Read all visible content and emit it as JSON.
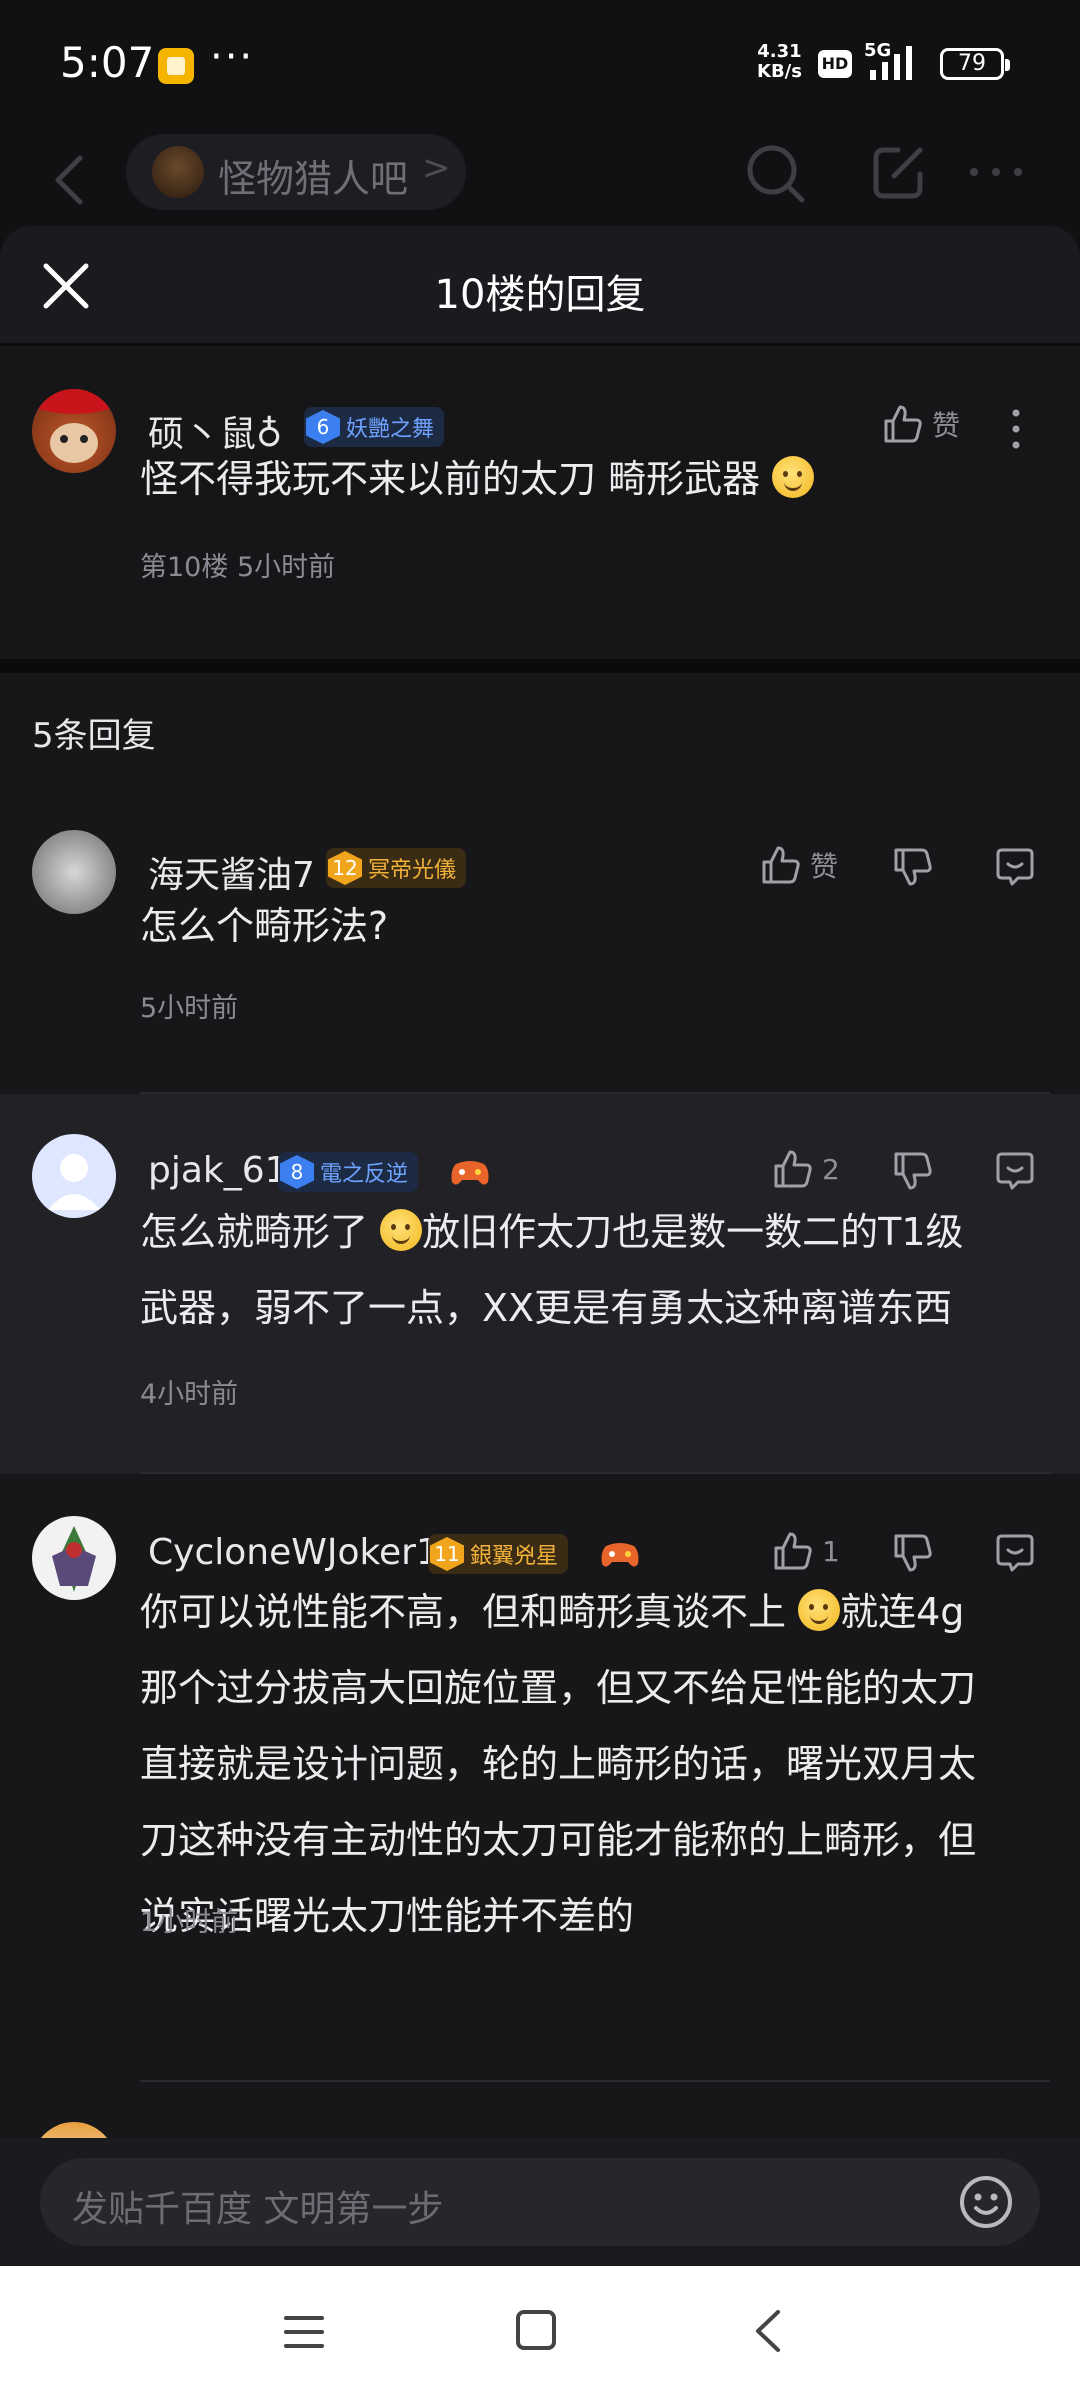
{
  "status": {
    "time": "5:07",
    "dots": "···",
    "speed_value": "4.31",
    "speed_unit": "KB/s",
    "hd": "HD",
    "network": "5G",
    "battery": "79"
  },
  "nav": {
    "forum_name": "怪物猎人吧",
    "chevron": ">"
  },
  "sheet": {
    "title": "10楼的回复"
  },
  "main_post": {
    "username": "硕丶鼠♁",
    "level": "6",
    "level_title": "妖艷之舞",
    "text": "怪不得我玩不来以前的太刀 畸形武器",
    "meta": "第10楼  5小时前",
    "like_label": "赞"
  },
  "replies_count": "5条回复",
  "replies": [
    {
      "username": "海天酱油7",
      "level": "12",
      "level_title": "冥帝光儀",
      "like_label": "赞",
      "text": "怎么个畸形法?",
      "time": "5小时前"
    },
    {
      "username": "pjak_61",
      "level": "8",
      "level_title": "電之反逆",
      "like_label": "2",
      "text_1": "怎么就畸形了",
      "text_2": "放旧作太刀也是数一数二的T1级",
      "text_3": "武器，弱不了一点，XX更是有勇太这种离谱东西",
      "time": "4小时前"
    },
    {
      "username": "CycloneWJoker1",
      "level": "11",
      "level_title": "銀翼兇星",
      "like_label": "1",
      "text_1": "你可以说性能不高，但和畸形真谈不上",
      "text_2": "就连4g",
      "text_3": "那个过分拔高大回旋位置，但又不给足性能的太刀",
      "text_4": "直接就是设计问题，轮的上畸形的话，曙光双月太",
      "text_5": "刀这种没有主动性的太刀可能才能称的上畸形，但",
      "text_6": "说实话曙光太刀性能并不差的",
      "time": "1小时前"
    }
  ],
  "input": {
    "placeholder": "发贴千百度 文明第一步"
  }
}
